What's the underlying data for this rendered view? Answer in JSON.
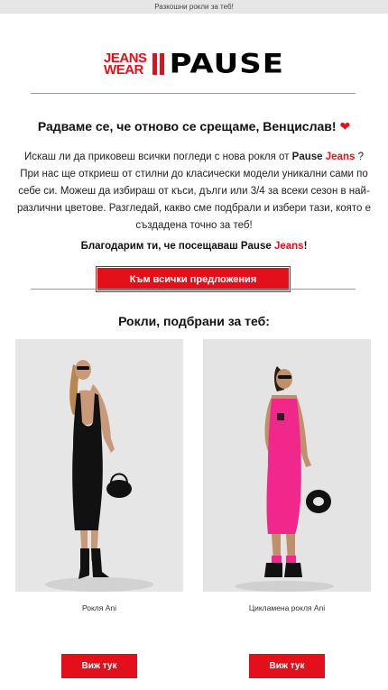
{
  "preheader": "Разкошни рокли за теб!",
  "logo": {
    "line1": "JEANS",
    "line2": "WEAR",
    "brand": "PAUSE"
  },
  "greeting": {
    "text": "Радваме се, че отново се срещаме, Венцислав!",
    "heart": "❤"
  },
  "intro": {
    "part1": "Искаш ли да приковеш всички погледи с нова рокля от ",
    "brand_pause": "Pause",
    "brand_jeans": "Jeans",
    "part2": " ?",
    "part3": "При нас ще откриеш от стилни до класически модели уникални сами по себе си. Можеш да избираш от къси, дълги или 3/4 за всеки сезон в най-различни цветове. Разгледай, какво сме подбрали и избери тази, която е създадена точно за теб!"
  },
  "thanks": {
    "part1": "Благодарим ти, че посещаваш ",
    "brand_pause": "Pause",
    "brand_jeans": "Jeans",
    "part2": "!"
  },
  "cta": {
    "label": "Към всички предложения"
  },
  "section_title": "Рокли, подбрани за теб:",
  "products": [
    {
      "name": "Рокля Ani",
      "button": "Виж тук",
      "dress_color": "#111111"
    },
    {
      "name": "Цикламена рокля Ani",
      "button": "Виж тук",
      "dress_color": "#f0288c"
    }
  ],
  "colors": {
    "accent": "#e3101b"
  }
}
